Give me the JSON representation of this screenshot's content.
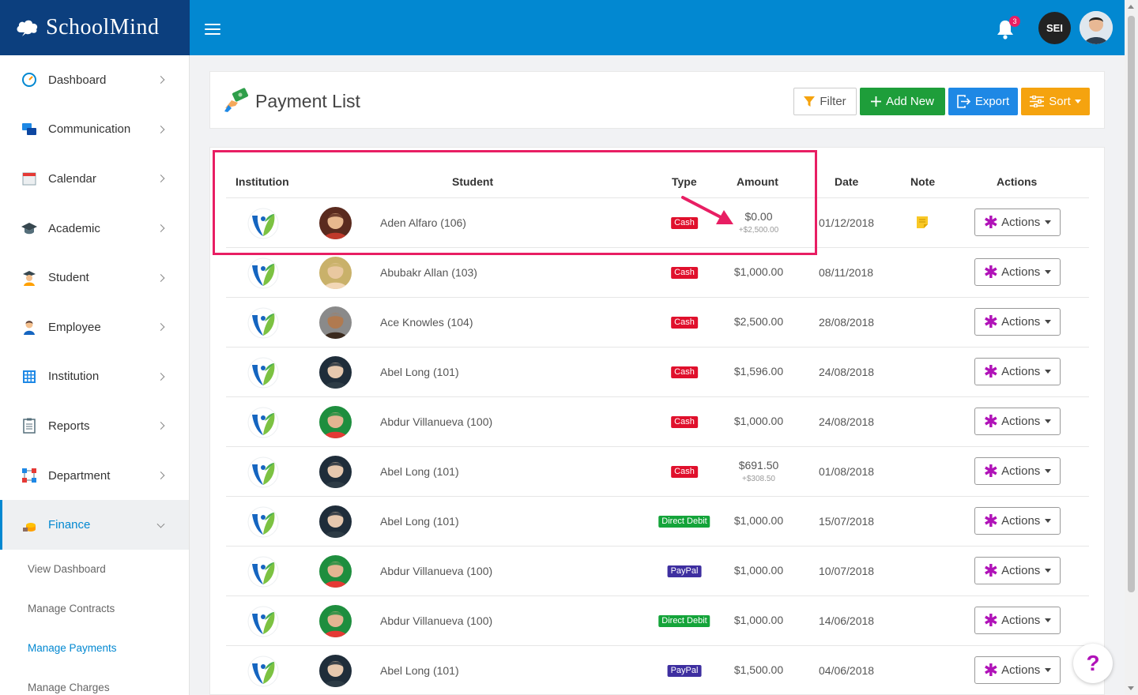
{
  "brand": {
    "name": "SchoolMind"
  },
  "header": {
    "notification_count": "3",
    "user_initials": "SEI"
  },
  "sidebar": {
    "items": [
      {
        "label": "Dashboard",
        "icon": "dashboard-icon"
      },
      {
        "label": "Communication",
        "icon": "chat-icon"
      },
      {
        "label": "Calendar",
        "icon": "calendar-icon"
      },
      {
        "label": "Academic",
        "icon": "graduation-cap-icon"
      },
      {
        "label": "Student",
        "icon": "student-icon"
      },
      {
        "label": "Employee",
        "icon": "employee-icon"
      },
      {
        "label": "Institution",
        "icon": "building-icon"
      },
      {
        "label": "Reports",
        "icon": "clipboard-icon"
      },
      {
        "label": "Department",
        "icon": "department-icon"
      },
      {
        "label": "Finance",
        "icon": "coins-icon",
        "active": true
      }
    ],
    "finance_subitems": [
      "View Dashboard",
      "Manage Contracts",
      "Manage Payments",
      "Manage Charges"
    ],
    "active_subitem": "Manage Payments"
  },
  "page": {
    "title": "Payment List",
    "buttons": {
      "filter": "Filter",
      "add_new": "Add New",
      "export": "Export",
      "sort": "Sort"
    }
  },
  "table": {
    "columns": [
      "Institution",
      "Student",
      "Type",
      "Amount",
      "Date",
      "Note",
      "Actions"
    ],
    "action_label": "Actions",
    "rows": [
      {
        "student": "Aden Alfaro (106)",
        "type": "Cash",
        "amount": "$0.00",
        "amount_sub": "+$2,500.00",
        "date": "01/12/2018",
        "note": true
      },
      {
        "student": "Abubakr Allan (103)",
        "type": "Cash",
        "amount": "$1,000.00",
        "amount_sub": "",
        "date": "08/11/2018",
        "note": false
      },
      {
        "student": "Ace Knowles (104)",
        "type": "Cash",
        "amount": "$2,500.00",
        "amount_sub": "",
        "date": "28/08/2018",
        "note": false
      },
      {
        "student": "Abel Long (101)",
        "type": "Cash",
        "amount": "$1,596.00",
        "amount_sub": "",
        "date": "24/08/2018",
        "note": false
      },
      {
        "student": "Abdur Villanueva (100)",
        "type": "Cash",
        "amount": "$1,000.00",
        "amount_sub": "",
        "date": "24/08/2018",
        "note": false
      },
      {
        "student": "Abel Long (101)",
        "type": "Cash",
        "amount": "$691.50",
        "amount_sub": "+$308.50",
        "date": "01/08/2018",
        "note": false
      },
      {
        "student": "Abel Long (101)",
        "type": "Direct Debit",
        "amount": "$1,000.00",
        "amount_sub": "",
        "date": "15/07/2018",
        "note": false
      },
      {
        "student": "Abdur Villanueva (100)",
        "type": "PayPal",
        "amount": "$1,000.00",
        "amount_sub": "",
        "date": "10/07/2018",
        "note": false
      },
      {
        "student": "Abdur Villanueva (100)",
        "type": "Direct Debit",
        "amount": "$1,000.00",
        "amount_sub": "",
        "date": "14/06/2018",
        "note": false
      },
      {
        "student": "Abel Long (101)",
        "type": "PayPal",
        "amount": "$1,500.00",
        "amount_sub": "",
        "date": "04/06/2018",
        "note": false
      }
    ]
  },
  "help": {
    "label": "?"
  },
  "colors": {
    "topbar": "#0288d1",
    "brand_bg": "#0c3f7e",
    "cash": "#e0102c",
    "direct_debit": "#14a43a",
    "paypal": "#3e2fa0",
    "highlight": "#e81e63",
    "actions_star": "#b012b8"
  }
}
